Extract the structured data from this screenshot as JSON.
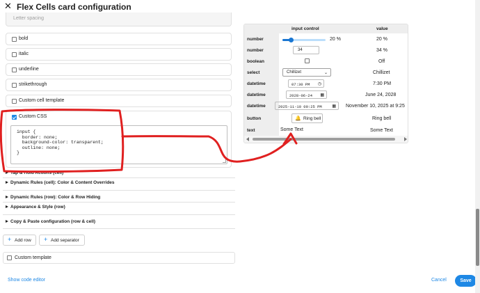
{
  "dialog": {
    "title": "Flex Cells card configuration",
    "close_icon": "close-icon"
  },
  "editor": {
    "letter_spacing_placeholder": "Letter spacing",
    "checkboxes": [
      {
        "label": "bold",
        "checked": false
      },
      {
        "label": "italic",
        "checked": false
      },
      {
        "label": "underline",
        "checked": false
      },
      {
        "label": "strikethrough",
        "checked": false
      },
      {
        "label": "Custom cell template",
        "checked": false
      }
    ],
    "custom_css": {
      "label": "Custom CSS",
      "checked": true,
      "value": "input {\n  border: none;\n  background-color: transparent;\n  outline: none;\n}"
    },
    "sections": [
      "Tap & Hold Actions (cell)",
      "Dynamic Rules (cell): Color & Content Overrides",
      "Dynamic Rules (row): Color & Row Hiding",
      "Appearance & Style (row)",
      "Copy & Paste configuration (row & cell)"
    ],
    "add_row_label": "Add row",
    "add_separator_label": "Add separator",
    "custom_template_label": "Custom template",
    "custom_template_checked": false
  },
  "footer": {
    "show_code_editor": "Show code editor",
    "cancel": "Cancel",
    "save": "Save",
    "accent_color": "#1e88e5"
  },
  "preview": {
    "headers": [
      "input control",
      "value"
    ],
    "rows": [
      {
        "label": "number",
        "control": "slider",
        "control_text": "20 %",
        "slider_fraction": 0.2,
        "value": "20 %"
      },
      {
        "label": "number",
        "control": "number",
        "control_text": "34",
        "value": "34 %"
      },
      {
        "label": "boolean",
        "control": "checkbox",
        "checked": false,
        "value": "Off"
      },
      {
        "label": "select",
        "control": "select",
        "control_text": "Chillizet",
        "value": "Chillizet"
      },
      {
        "label": "datetime",
        "control": "time",
        "control_text": "07:30 PM",
        "value": "7:30 PM"
      },
      {
        "label": "datetime",
        "control": "date",
        "control_text": "2028-06-24",
        "value": "June 24, 2028"
      },
      {
        "label": "datetime",
        "control": "datetime",
        "control_text": "2025-11-10 09:25 PM",
        "value": "November 10, 2025 at 9:25"
      },
      {
        "label": "button",
        "control": "button",
        "control_text": "Ring bell",
        "value": "Ring bell"
      },
      {
        "label": "text",
        "control": "text",
        "control_text": "Some Text",
        "value": "Some Text"
      }
    ]
  },
  "annotation_color": "#e02020"
}
